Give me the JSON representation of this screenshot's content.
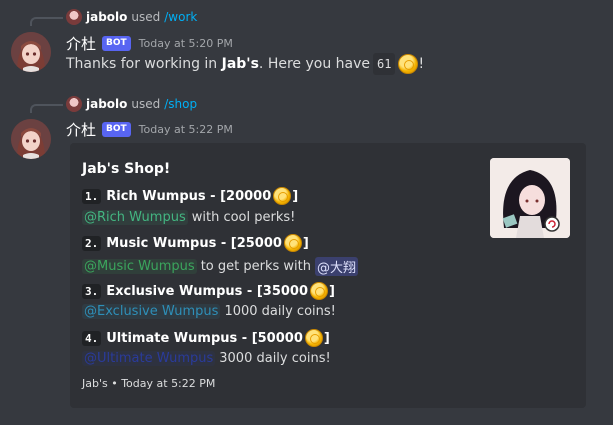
{
  "messages": [
    {
      "reply_user": "jabolo",
      "reply_used": "used",
      "reply_command": "/work",
      "author": "介杜",
      "bot_tag": "BOT",
      "timestamp": "Today at 5:20 PM",
      "text_before": "Thanks for working in",
      "text_bold": "Jab's",
      "text_middle": ". Here you have",
      "amount": "61",
      "text_after": "!",
      "coin_icon": "coin-icon"
    },
    {
      "reply_user": "jabolo",
      "reply_used": "used",
      "reply_command": "/shop",
      "author": "介杜",
      "bot_tag": "BOT",
      "timestamp": "Today at 5:22 PM"
    }
  ],
  "embed": {
    "title": "Jab's Shop!",
    "thumbnail": "anime-girl-thumbnail",
    "items": [
      {
        "number": "1.",
        "title": "Rich Wumpus - [20000",
        "close": "]",
        "role": "@Rich Wumpus",
        "desc": "with cool perks!",
        "role_color": "#43b581"
      },
      {
        "number": "2.",
        "title": "Music Wumpus - [25000",
        "close": "]",
        "role": "@Music Wumpus",
        "desc": "to get perks with",
        "mention": "@大翔",
        "role_color": "#3ba55d"
      },
      {
        "number": "3.",
        "title": "Exclusive Wumpus - [35000",
        "close": "]",
        "role": "@Exclusive Wumpus",
        "desc": "1000 daily coins!",
        "role_color": "#2e8fb8"
      },
      {
        "number": "4.",
        "title": "Ultimate Wumpus - [50000",
        "close": "]",
        "role": "@Ultimate Wumpus",
        "desc": "3000 daily coins!",
        "role_color": "#2a3b9a"
      }
    ],
    "footer": "Jab's • Today at 5:22 PM"
  },
  "colors": {
    "background": "#36393f",
    "embed_background": "#2f3136",
    "bot_tag": "#5865f2",
    "command_link": "#00aff4"
  }
}
